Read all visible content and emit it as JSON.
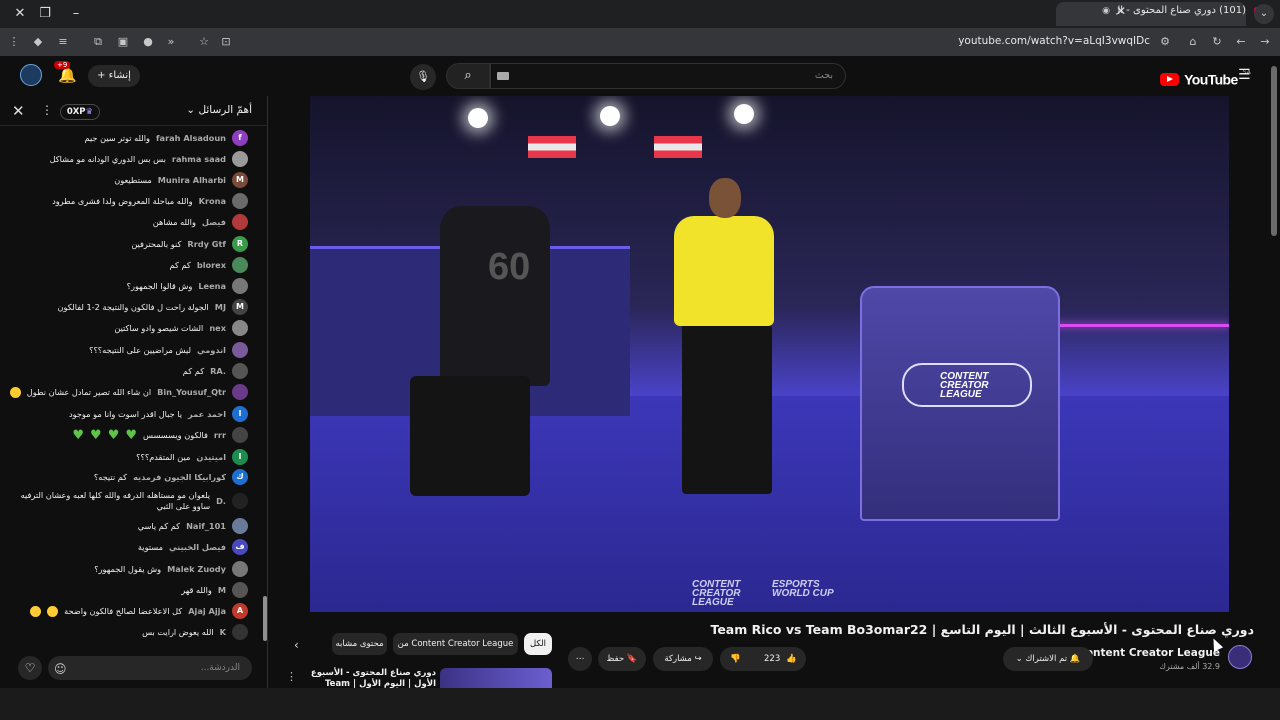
{
  "browser": {
    "tab_title": "(101) دوري صناع المحتوى - ال",
    "url": "youtube.com/watch?v=aLqI3vwqIDc"
  },
  "header": {
    "notification_count": "+9",
    "create_label": "إنشاء",
    "search_placeholder": "بحث",
    "logo_text": "YouTube",
    "country": "SA"
  },
  "chat": {
    "title": "أهمّ الرسائل",
    "xp_label": "0XP",
    "input_placeholder": "الدردشة...",
    "messages": [
      {
        "name": "farah Alsadoun",
        "text": "والله توتر سين جيم",
        "initial": "f",
        "color": "#8e3fbf"
      },
      {
        "name": "rahma saad",
        "text": "بس بس الدوري الودانه مو مشاكل",
        "initial": "",
        "color": "#9a9a9a"
      },
      {
        "name": "Munira Alharbi",
        "text": "مستطيعون",
        "initial": "M",
        "color": "#7a4a3a"
      },
      {
        "name": "Krona",
        "text": "والله مباحلة المعروض ولدا فشرى مطرود",
        "initial": "",
        "color": "#6a6a6a"
      },
      {
        "name": "فيصل",
        "text": "والله مشاهن",
        "initial": "",
        "color": "#b03a3a"
      },
      {
        "name": "Rrdy Gtf",
        "text": "كنو بالمحترفين",
        "initial": "R",
        "color": "#3a9a4a"
      },
      {
        "name": "blorex",
        "text": "كم كم",
        "initial": "",
        "color": "#4a8a5a"
      },
      {
        "name": "Leena",
        "text": "وش قالوا الجمهور؟",
        "initial": "",
        "color": "#777777"
      },
      {
        "name": "MJ",
        "text": "الجولة راحت ل فالكون والنتيجة 2-1 لفالكون",
        "initial": "M",
        "color": "#444444"
      },
      {
        "name": "nex",
        "text": "الشات شيصو وادو ساكتين",
        "initial": "",
        "color": "#888888"
      },
      {
        "name": "اندومي",
        "text": "ليش مراضيين على النتيجه؟؟؟",
        "initial": "",
        "color": "#7a5a9a"
      },
      {
        "name": "RA.",
        "text": "كم كم",
        "initial": "",
        "color": "#555555"
      },
      {
        "name": "Bin_Yousuf_Qtr",
        "text": "ان شاء الله تصير تمادل عشان نطول",
        "initial": "",
        "color": "#6a3a8a"
      },
      {
        "name": "احمد عمر",
        "text": "يا جبال اقدر اسوت وانا مو موجود",
        "initial": "ا",
        "color": "#1f6fd0"
      },
      {
        "name": "rrr",
        "text": "فالكون ويسسسس",
        "initial": "",
        "color": "#444444"
      },
      {
        "name": "اميتيدن",
        "text": "مين المتقدم؟؟؟",
        "initial": "ا",
        "color": "#1e8c4e"
      },
      {
        "name": "كورابيكا الجيون فرمديه",
        "text": "كم نتيجه؟",
        "initial": "ك",
        "color": "#1f6fd0"
      },
      {
        "name": "D.",
        "text": "يلعوان مو مستاهله الدرفه والله كلها لعبه وعشان الترفيه ساوو على الثبي",
        "initial": "",
        "color": "#222222"
      },
      {
        "name": "Naif_101",
        "text": "كم كم ياسي",
        "initial": "",
        "color": "#6a7a9a"
      },
      {
        "name": "فيصل الخبيني",
        "text": "مستوية",
        "initial": "ف",
        "color": "#4a4ac0"
      },
      {
        "name": "Malek Zuody",
        "text": "وش يقول الجمهور؟",
        "initial": "",
        "color": "#777777"
      },
      {
        "name": "M",
        "text": "والله قهر",
        "initial": "",
        "color": "#555555"
      },
      {
        "name": "Ajaj Ajja",
        "text": "كل الاعلاعضا لصالح فالكون واضحة",
        "initial": "A",
        "color": "#c0392b"
      },
      {
        "name": "K",
        "text": "الله يعوض ارايت بس",
        "initial": "",
        "color": "#333333"
      }
    ]
  },
  "video": {
    "podium_text": "CONTENT CREATOR LEAGUE",
    "jersey_number": "60",
    "watermark_left": "CONTENT CREATOR LEAGUE",
    "watermark_right": "ESPORTS WORLD CUP",
    "title": "دوري صناع المحتوى - الأسبوع الثالث | اليوم التاسع | Team Rico vs Team Bo3omar22"
  },
  "channel": {
    "name": "Content Creator League",
    "subscribers": "32.9 ألف مشترك",
    "subscribed_label": "تم الاشتراك"
  },
  "actions": {
    "likes": "223",
    "share_label": "مشاركة",
    "save_label": "حفظ"
  },
  "chips": {
    "all": "الكل",
    "from_channel": "من Content Creator League",
    "related": "محتوى مشابه"
  },
  "recommendation": {
    "title": "دوري صناع المحتوى - الأسبوع الأول | اليوم الأول | Team Thamer vs Team"
  }
}
